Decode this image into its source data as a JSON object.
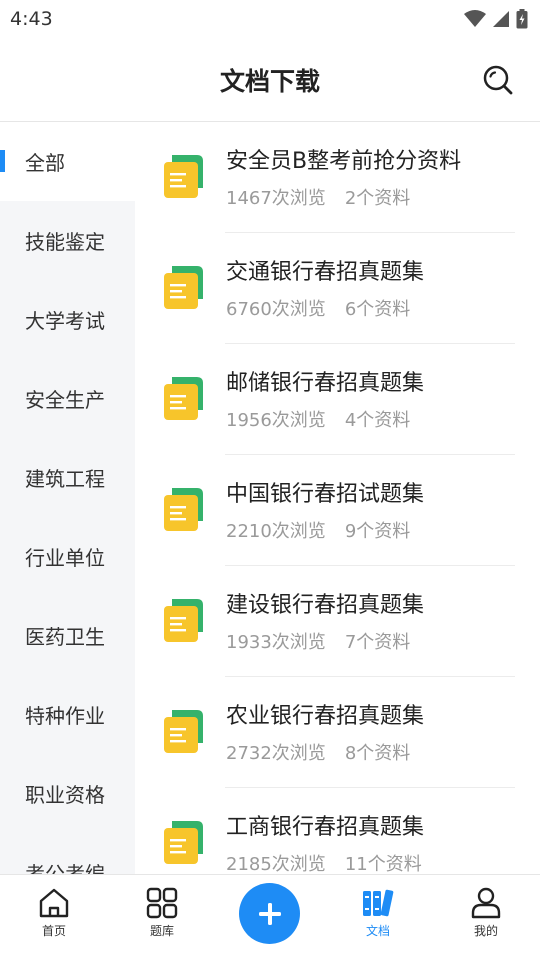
{
  "status_bar": {
    "time": "4:43"
  },
  "header": {
    "title": "文档下载"
  },
  "sidebar": {
    "items": [
      {
        "label": "全部"
      },
      {
        "label": "技能鉴定"
      },
      {
        "label": "大学考试"
      },
      {
        "label": "安全生产"
      },
      {
        "label": "建筑工程"
      },
      {
        "label": "行业单位"
      },
      {
        "label": "医药卫生"
      },
      {
        "label": "特种作业"
      },
      {
        "label": "职业资格"
      },
      {
        "label": "考公考编"
      }
    ]
  },
  "documents": [
    {
      "title": "安全员B整考前抢分资料",
      "views": "1467次浏览",
      "count": "2个资料"
    },
    {
      "title": "交通银行春招真题集",
      "views": "6760次浏览",
      "count": "6个资料"
    },
    {
      "title": "邮储银行春招真题集",
      "views": "1956次浏览",
      "count": "4个资料"
    },
    {
      "title": "中国银行春招试题集",
      "views": "2210次浏览",
      "count": "9个资料"
    },
    {
      "title": "建设银行春招真题集",
      "views": "1933次浏览",
      "count": "7个资料"
    },
    {
      "title": "农业银行春招真题集",
      "views": "2732次浏览",
      "count": "8个资料"
    },
    {
      "title": "工商银行春招真题集",
      "views": "2185次浏览",
      "count": "11个资料"
    }
  ],
  "bottom_nav": {
    "items": [
      {
        "label": "首页",
        "icon": "home-icon"
      },
      {
        "label": "题库",
        "icon": "grid-icon"
      },
      {
        "label": "",
        "icon": "plus-icon"
      },
      {
        "label": "文档",
        "icon": "books-icon"
      },
      {
        "label": "我的",
        "icon": "user-icon"
      }
    ]
  },
  "colors": {
    "accent": "#1e8cf5",
    "doc_yellow": "#f7c52b",
    "doc_green": "#35b26b",
    "sidebar_bg": "#f5f6f8"
  }
}
